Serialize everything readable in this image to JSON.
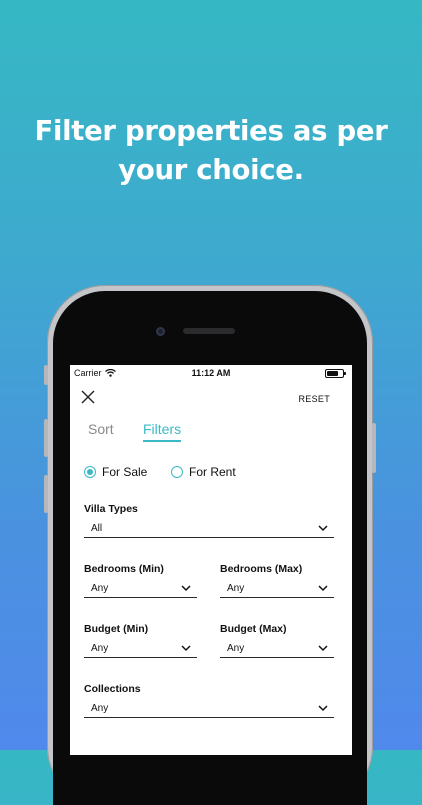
{
  "headline": {
    "line1": "Filter properties as per",
    "line2": "your choice."
  },
  "status_bar": {
    "carrier": "Carrier",
    "time": "11:12 AM"
  },
  "header": {
    "reset_label": "RESET"
  },
  "tabs": [
    {
      "label": "Sort",
      "active": false
    },
    {
      "label": "Filters",
      "active": true
    }
  ],
  "listing_type": {
    "options": [
      {
        "label": "For Sale",
        "selected": true
      },
      {
        "label": "For Rent",
        "selected": false
      }
    ]
  },
  "filters": {
    "villa_types": {
      "label": "Villa Types",
      "value": "All"
    },
    "bedrooms_min": {
      "label": "Bedrooms (Min)",
      "value": "Any"
    },
    "bedrooms_max": {
      "label": "Bedrooms (Max)",
      "value": "Any"
    },
    "budget_min": {
      "label": "Budget (Min)",
      "value": "Any"
    },
    "budget_max": {
      "label": "Budget (Max)",
      "value": "Any"
    },
    "collections": {
      "label": "Collections",
      "value": "Any"
    }
  },
  "colors": {
    "accent": "#3bb9c4",
    "background_top": "#36b8c4",
    "background_bottom": "#5089ec"
  }
}
